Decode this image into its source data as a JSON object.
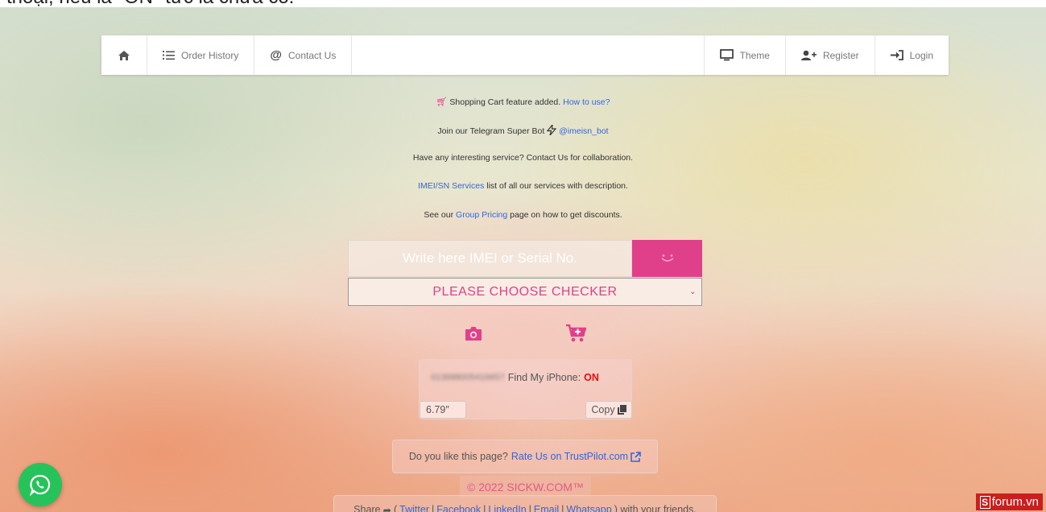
{
  "overlay": {
    "top_caption": "thoại, nếu là \"ON\" tức là chưa có.",
    "watermark": "forum.vn",
    "watermark_letter": "S"
  },
  "nav": {
    "home_icon": "home-icon",
    "order_history": "Order History",
    "contact_us": "Contact Us",
    "theme": "Theme",
    "register": "Register",
    "login": "Login"
  },
  "announcements": {
    "cart_text": "Shopping Cart feature added.",
    "cart_link": "How to use?",
    "telegram_text": "Join our Telegram Super Bot",
    "telegram_link": "@imeisn_bot",
    "collab": "Have any interesting service? Contact Us for collaboration.",
    "services_link": "IMEI/SN Services",
    "services_text": "list of all our services with description.",
    "pricing_pre": "See our",
    "pricing_link": "Group Pricing",
    "pricing_post": "page on how to get discounts."
  },
  "checker": {
    "input_placeholder": "Write here IMEI or Serial No.",
    "select_value": "PLEASE CHOOSE CHECKER"
  },
  "result": {
    "imei": "013688005416657",
    "label": "Find My iPhone:",
    "status": "ON",
    "screen_size": "6.79″",
    "copy_label": "Copy"
  },
  "footer": {
    "rate_text": "Do you like this page?",
    "rate_link": "Rate Us on TrustPilot.com",
    "copyright": "© 2022 SICKW.COM™",
    "share_pre": "Share",
    "share_open": "(",
    "twitter": "Twitter",
    "facebook": "Facebook",
    "linkedin": "LinkedIn",
    "email": "Email",
    "whatsapp": "Whatsapp",
    "sep": "|",
    "share_post": ") with your friends."
  },
  "colors": {
    "accent_pink": "#e0408a",
    "link_blue": "#3366dd",
    "status_red": "#e01010",
    "whatsapp_green": "#26c35a"
  }
}
